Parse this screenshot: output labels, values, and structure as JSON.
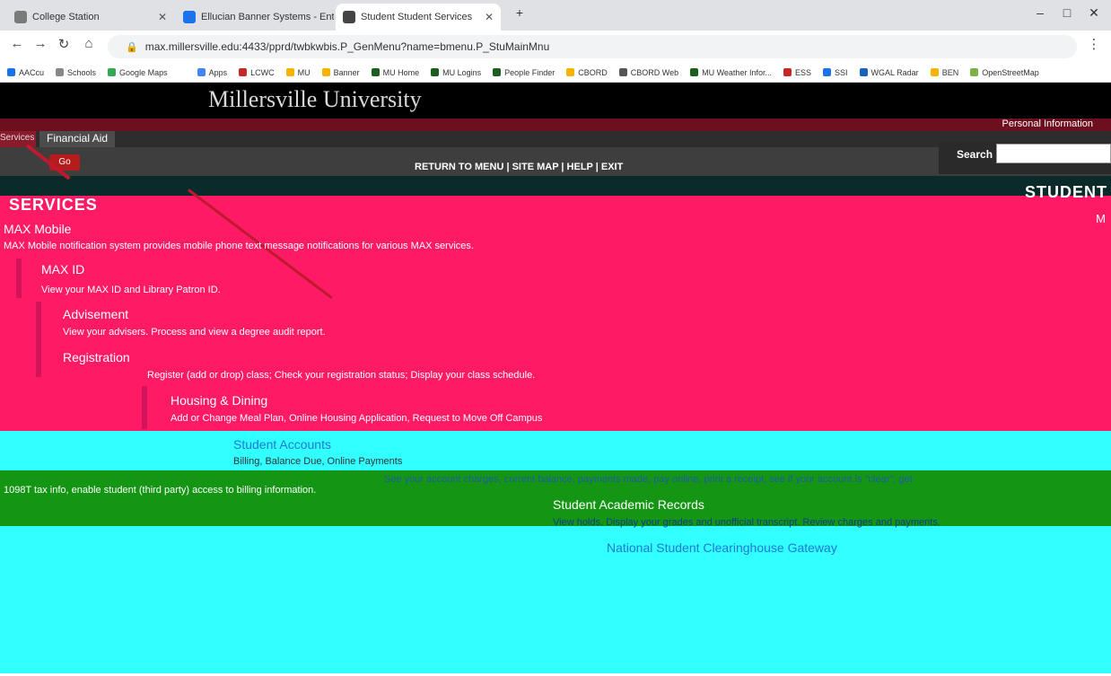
{
  "browser": {
    "tabs": [
      {
        "title": "College Station"
      },
      {
        "title": "Ellucian Banner Systems - Enterprise"
      },
      {
        "title": "Student Student Services"
      }
    ],
    "url": "max.millersville.edu:4433/pprd/twbkwbis.P_GenMenu?name=bmenu.P_StuMainMnu",
    "bookmarks": [
      "Apps",
      "LCWC",
      "MU",
      "Banner",
      "MU Home",
      "MU Logins",
      "People Finder",
      "CBORD",
      "CBORD Web",
      "MU Weather Infor...",
      "ESS",
      "SSI",
      "WGAL Radar",
      "BEN",
      "OpenStreetMap"
    ],
    "bookmarks_row2": [
      "AACcu",
      "Schools",
      "Google Maps"
    ]
  },
  "page": {
    "university": "Millersville University",
    "tabs": {
      "personal": "Personal Information",
      "financial_aid": "Financial Aid",
      "left_tab": "Services"
    },
    "go_button": "Go",
    "menu_links": "RETURN TO MENU | SITE MAP | HELP | EXIT",
    "search_label": "Search",
    "section_title": "SERVICES",
    "student_heading": "STUDENT",
    "right_fragment": "M",
    "items": [
      {
        "title": "MAX Mobile",
        "desc": "MAX Mobile notification system provides mobile phone text message notifications for various MAX services."
      },
      {
        "title": "MAX ID",
        "desc": "View your MAX ID and Library Patron ID."
      },
      {
        "title": "Advisement",
        "desc": "View your advisers. Process and view a degree audit report."
      },
      {
        "title": "Registration",
        "desc": "Register (add or drop) class; Check your registration status; Display your class schedule."
      },
      {
        "title": "Housing & Dining",
        "desc": "Add or Change Meal Plan, Online Housing Application, Request to Move Off Campus"
      },
      {
        "title": "Student Accounts",
        "desc": "Billing, Balance Due, Online Payments"
      },
      {
        "title": "",
        "desc": "See your account charges, current balance, payments made, pay online, print a receipt, see if your account is \"clear\", get"
      },
      {
        "title": "",
        "desc": "1098T tax info, enable student (third party) access to billing information."
      },
      {
        "title": "Student Academic Records",
        "desc": "View holds. Display your grades and unofficial transcript. Review charges and payments."
      },
      {
        "title": "National Student Clearinghouse Gateway",
        "desc": ""
      }
    ]
  },
  "colors": {
    "pink_bg": "#ff1a66",
    "cyan_bg": "#32ffff",
    "green_band": "#149614",
    "banner": "#000000",
    "menubar": "#6d0f1e"
  }
}
